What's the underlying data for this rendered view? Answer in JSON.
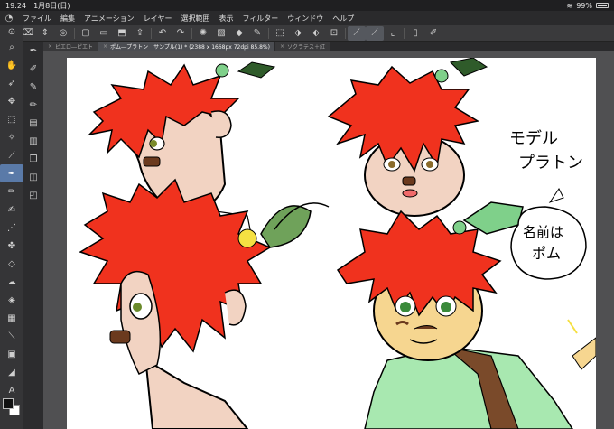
{
  "status": {
    "time": "19:24",
    "date": "1月8日(日)",
    "battery": "99%"
  },
  "menu": [
    "ファイル",
    "編集",
    "アニメーション",
    "レイヤー",
    "選択範囲",
    "表示",
    "フィルター",
    "ウィンドウ",
    "ヘルプ"
  ],
  "tabs": [
    {
      "label": "ピエロ―ピエト"
    },
    {
      "label": "ポム―プラトン　サンプル(1) * (2388 x 1668px 72dpi 85.8%)"
    },
    {
      "label": "ソクラテス＋紅"
    }
  ],
  "canvas_text": {
    "model_line1": "モデル",
    "model_line2": "プラトン",
    "name_line1": "名前は",
    "name_line2": "ポム"
  },
  "colors": {
    "hair": "#f0321e",
    "skin": "#f2d3c2",
    "skin_tan": "#f6d690",
    "leaf": "#7fd08a",
    "shirt": "#a8e8b0",
    "accent": "#5a7aa8"
  }
}
